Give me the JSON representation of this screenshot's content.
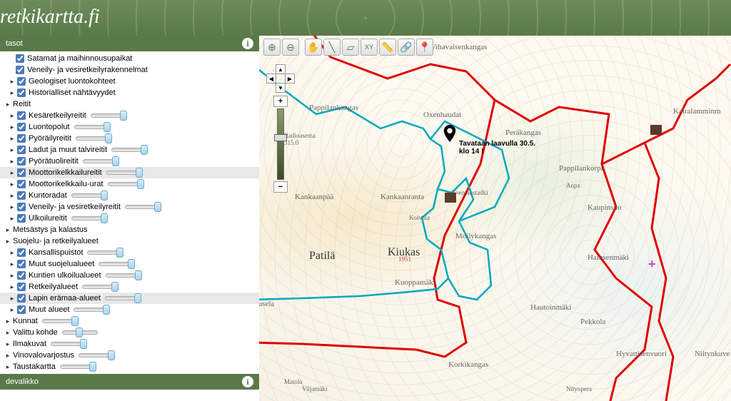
{
  "site": {
    "title": "retkikartta.fi"
  },
  "panels": {
    "layers_title": "tasot",
    "bottom_title": "devalikko"
  },
  "layers": [
    {
      "label": "Satamat ja maihinnousupaikat",
      "checked": true,
      "indent": 2,
      "slider": false
    },
    {
      "label": "Veneily- ja vesiretkeilyrakennelmat",
      "checked": true,
      "indent": 2,
      "slider": false
    },
    {
      "label": "Geologiset luontokohteet",
      "checked": true,
      "indent": 1,
      "slider": false,
      "expand": true
    },
    {
      "label": "Historialliset nähtävyydet",
      "checked": true,
      "indent": 1,
      "slider": false,
      "expand": true
    },
    {
      "label": "Reitit",
      "checked": false,
      "indent": 0,
      "slider": false,
      "expand": true,
      "noCheckbox": true
    },
    {
      "label": "Kesäretkeilyreitit",
      "checked": true,
      "indent": 1,
      "slider": true,
      "expand": true
    },
    {
      "label": "Luontopolut",
      "checked": true,
      "indent": 1,
      "slider": true,
      "expand": true
    },
    {
      "label": "Pyöräilyreitit",
      "checked": true,
      "indent": 1,
      "slider": true,
      "expand": true
    },
    {
      "label": "Ladut ja muut talvireitit",
      "checked": true,
      "indent": 1,
      "slider": true,
      "expand": true
    },
    {
      "label": "Pyörätuolireitit",
      "checked": true,
      "indent": 1,
      "slider": true,
      "expand": true
    },
    {
      "label": "Moottorikelkkailureitit",
      "checked": true,
      "indent": 1,
      "slider": true,
      "expand": true,
      "highlighted": true
    },
    {
      "label": "Moottorikelkkailu-urat",
      "checked": true,
      "indent": 1,
      "slider": true,
      "expand": true
    },
    {
      "label": "Kuntoradat",
      "checked": true,
      "indent": 1,
      "slider": true,
      "expand": true
    },
    {
      "label": "Veneily- ja vesiretkeilyreitit",
      "checked": true,
      "indent": 1,
      "slider": true,
      "expand": true
    },
    {
      "label": "Ulkoilureitit",
      "checked": true,
      "indent": 1,
      "slider": true,
      "expand": true
    },
    {
      "label": "Metsästys ja kalastus",
      "checked": false,
      "indent": 0,
      "slider": false,
      "expand": true,
      "noCheckbox": true
    },
    {
      "label": "Suojelu- ja retkeilyalueet",
      "checked": false,
      "indent": 0,
      "slider": false,
      "expand": true,
      "noCheckbox": true
    },
    {
      "label": "Kansallispuistot",
      "checked": true,
      "indent": 1,
      "slider": true,
      "expand": true
    },
    {
      "label": "Muut suojelualueet",
      "checked": true,
      "indent": 1,
      "slider": true,
      "expand": true
    },
    {
      "label": "Kuntien ulkoilualueet",
      "checked": true,
      "indent": 1,
      "slider": true,
      "expand": true
    },
    {
      "label": "Retkeilyalueet",
      "checked": true,
      "indent": 1,
      "slider": true,
      "expand": true
    },
    {
      "label": "Lapin erämaa-alueet",
      "checked": true,
      "indent": 1,
      "slider": true,
      "expand": true,
      "highlighted": true
    },
    {
      "label": "Muut alueet",
      "checked": true,
      "indent": 1,
      "slider": true,
      "expand": true
    },
    {
      "label": "Kunnat",
      "checked": false,
      "indent": 0,
      "slider": true,
      "expand": true,
      "noCheckbox": true
    },
    {
      "label": "Valittu kohde",
      "checked": false,
      "indent": 0,
      "slider": true,
      "expand": true,
      "noCheckbox": true,
      "sliderMid": true
    },
    {
      "label": "Ilmakuvat",
      "checked": false,
      "indent": 0,
      "slider": true,
      "expand": true,
      "noCheckbox": true
    },
    {
      "label": "Vinovalovarjostus",
      "checked": false,
      "indent": 0,
      "slider": true,
      "expand": true,
      "noCheckbox": true
    },
    {
      "label": "Taustakartta",
      "checked": false,
      "indent": 0,
      "slider": true,
      "expand": true,
      "noCheckbox": true
    }
  ],
  "toolbar": [
    "zoom-in",
    "zoom-out",
    "pan",
    "measure-line",
    "measure-area",
    "coords",
    "ruler",
    "link",
    "marker"
  ],
  "marker": {
    "line1": "Tavataan laavulla 30.5.",
    "line2": "klo 14 !"
  },
  "map_labels": {
    "vihavaisenkangas": "Vihavaisenkangas",
    "pappilankangas": "Pappilankangas",
    "oxenhaudat": "Oxenhaudat",
    "perakangas": "Peräkangas",
    "radioasema": "Radioasema",
    "radio_height": "315.0",
    "kairalamminm": "Kairalamminm",
    "pappilankorpi": "Pappilankorpi",
    "kankaanpaa": "Kankaanpää",
    "kankaanranta": "Kankaanranta",
    "tuentaustadki": "Tuentaustadki",
    "anpx": "Anpx",
    "koivula": "Koivula",
    "moilykangas": "Moilykangas",
    "kaupinsuo": "Kaupinsuo",
    "patila": "Patilä",
    "kiukas": "Kiukas",
    "year": "1951",
    "halosenmaki": "Halosenmäki",
    "kuoppamaki": "Kuoppamäki",
    "iusela": "Iusela",
    "hautoinmaki": "Hautoinmäki",
    "pekkola": "Pekkola",
    "korkikangas": "Korkikangas",
    "hyvattisenvuori": "Hyvattisenvuori",
    "niitynkuve": "Niitynkuve",
    "matola": "Matola",
    "viljamaki": "Viljamäki",
    "nityopera": "Nityopera"
  }
}
